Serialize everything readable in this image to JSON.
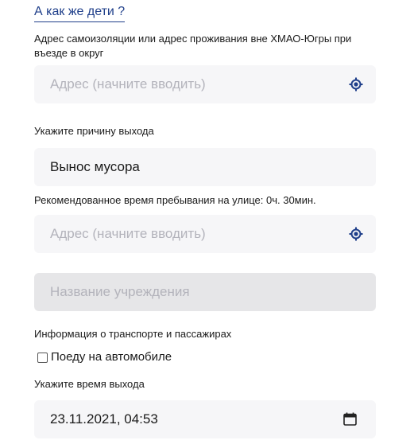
{
  "kids_link": "А как же дети ?",
  "address_section": {
    "label": "Адрес самоизоляции или адрес проживания вне ХМАО-Югры при въезде в округ",
    "input": {
      "placeholder": "Адрес (начните вводить)",
      "value": ""
    },
    "icon": "geolocation-target-icon"
  },
  "reason_section": {
    "label": "Укажите причину выхода",
    "value": "Вынос мусора"
  },
  "recommended_time": "Рекомендованное время пребывания на улице: 0ч. 30мин.",
  "destination_address": {
    "input": {
      "placeholder": "Адрес (начните вводить)",
      "value": ""
    },
    "icon": "geolocation-target-icon"
  },
  "institution": {
    "placeholder": "Название учреждения",
    "disabled": true
  },
  "transport_section": {
    "label": "Информация о транспорте и пассажирах",
    "checkbox_label": "Поеду на автомобиле",
    "checked": false
  },
  "exit_time_section": {
    "label": "Укажите время выхода",
    "value": "23.11.2021, 04:53",
    "icon": "calendar-icon"
  },
  "colors": {
    "link": "#1f3f8a",
    "icon": "#1f3f8a",
    "field_bg": "#f6f6f8",
    "disabled_bg": "#e6e6e8",
    "placeholder": "#b3b3bb"
  }
}
